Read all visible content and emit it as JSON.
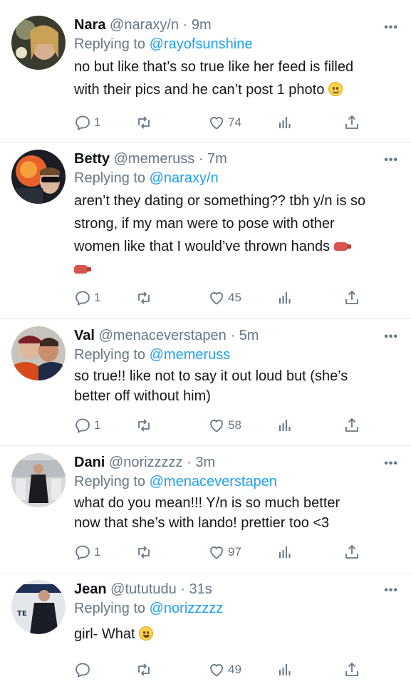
{
  "tweets": [
    {
      "name": "Nara",
      "handle": "@naraxy/n",
      "time": "9m",
      "replying_label": "Replying to",
      "replying_to": "@rayofsunshine",
      "text_lines": [
        "no but like that’s so true like her feed is filled",
        "with their pics and he can’t post 1 photo"
      ],
      "emoji": "slightly-smiling-face",
      "replies": "1",
      "likes": "74"
    },
    {
      "name": "Betty",
      "handle": "@memeruss",
      "time": "7m",
      "replying_label": "Replying to",
      "replying_to": "@naraxy/n",
      "text_lines": [
        "aren’t they dating or something?? tbh y/n is so",
        "strong, if my man were to pose with other",
        "women like that I would’ve thrown hands"
      ],
      "emoji": "boxing-glove",
      "replies": "1",
      "likes": "45"
    },
    {
      "name": "Val",
      "handle": "@menaceverstapen",
      "time": "5m",
      "replying_label": "Replying to",
      "replying_to": "@memeruss",
      "text_lines": [
        "so true!! like not to say it out loud but (she’s",
        "better off without him)"
      ],
      "replies": "1",
      "likes": "58"
    },
    {
      "name": "Dani",
      "handle": "@norizzzzz",
      "time": "3m",
      "replying_label": "Replying to",
      "replying_to": "@menaceverstapen",
      "text_lines": [
        "what do you mean!!! Y/n is so much better",
        "now that she’s  with lando! prettier too <3"
      ],
      "replies": "1",
      "likes": "97"
    },
    {
      "name": "Jean",
      "handle": "@tututudu",
      "time": "31s",
      "replying_label": "Replying to",
      "replying_to": "@norizzzzz",
      "text_lines": [
        "girl- What"
      ],
      "emoji": "grinning-face",
      "replies": "",
      "likes": "49",
      "avatar_text": "TE"
    }
  ],
  "separator": "·",
  "icons": [
    "reply-icon",
    "retweet-icon",
    "like-icon",
    "analytics-icon",
    "share-icon",
    "more-icon"
  ],
  "colors": {
    "link": "#1da1f2",
    "muted": "#657786",
    "text": "#14171a"
  }
}
